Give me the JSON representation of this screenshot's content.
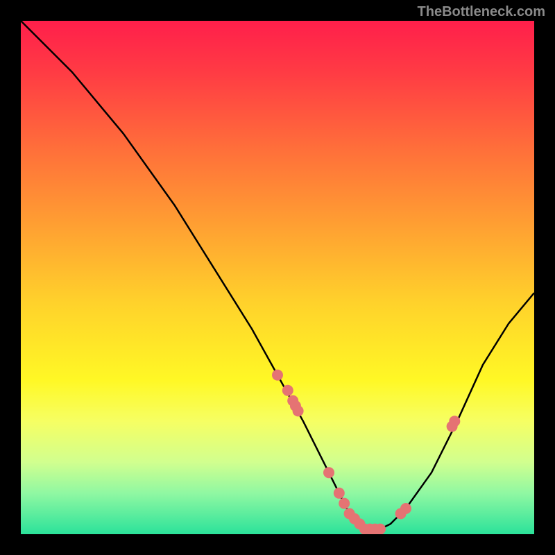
{
  "attribution": "TheBottleneck.com",
  "chart_data": {
    "type": "line",
    "title": "",
    "xlabel": "",
    "ylabel": "",
    "xlim": [
      0,
      100
    ],
    "ylim": [
      0,
      100
    ],
    "curve": {
      "x": [
        0,
        5,
        10,
        15,
        20,
        25,
        30,
        35,
        40,
        45,
        50,
        55,
        60,
        62,
        64,
        66,
        68,
        70,
        72,
        75,
        80,
        85,
        90,
        95,
        100
      ],
      "y": [
        100,
        95,
        90,
        84,
        78,
        71,
        64,
        56,
        48,
        40,
        31,
        22,
        12,
        8,
        4,
        2,
        1,
        1,
        2,
        5,
        12,
        22,
        33,
        41,
        47
      ]
    },
    "markers": {
      "x": [
        50,
        52,
        53,
        53.5,
        54,
        60,
        62,
        63,
        64,
        65,
        66,
        67,
        68,
        69,
        70,
        74,
        75,
        84,
        84.5
      ],
      "y": [
        31,
        28,
        26,
        25,
        24,
        12,
        8,
        6,
        4,
        3,
        2,
        1,
        1,
        1,
        1,
        4,
        5,
        21,
        22
      ]
    },
    "gradient_stops": [
      {
        "offset": 0.0,
        "color": "#ff1f4b"
      },
      {
        "offset": 0.1,
        "color": "#ff3b44"
      },
      {
        "offset": 0.25,
        "color": "#ff6f3a"
      },
      {
        "offset": 0.4,
        "color": "#ffa032"
      },
      {
        "offset": 0.55,
        "color": "#ffd22b"
      },
      {
        "offset": 0.7,
        "color": "#fff825"
      },
      {
        "offset": 0.78,
        "color": "#f6ff63"
      },
      {
        "offset": 0.86,
        "color": "#d1ff8f"
      },
      {
        "offset": 0.92,
        "color": "#90f8a2"
      },
      {
        "offset": 1.0,
        "color": "#2be29a"
      }
    ],
    "marker_color": "#e57373"
  }
}
